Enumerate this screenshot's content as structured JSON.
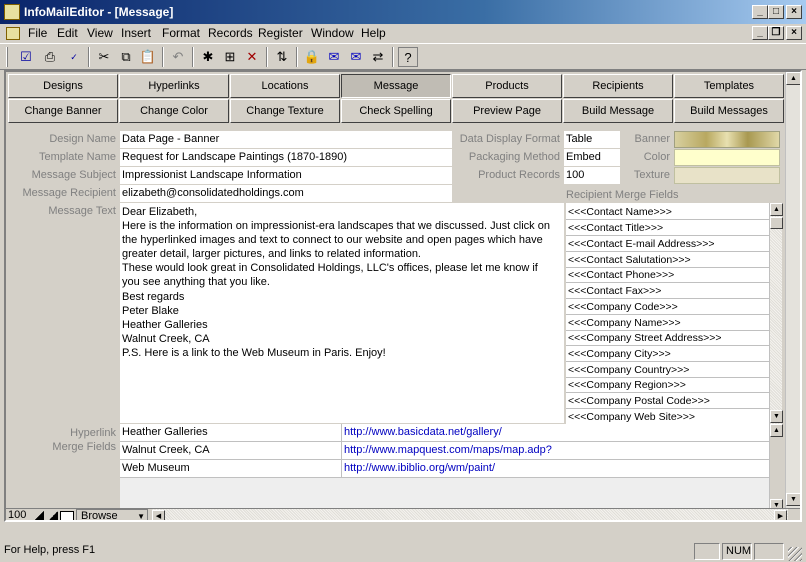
{
  "window": {
    "title": "InfoMailEditor - [Message]"
  },
  "menu": [
    "File",
    "Edit",
    "View",
    "Insert",
    "Format",
    "Records",
    "Register",
    "Window",
    "Help"
  ],
  "tabs_row1": [
    "Designs",
    "Hyperlinks",
    "Locations",
    "Message",
    "Products",
    "Recipients",
    "Templates"
  ],
  "tabs_row2": [
    "Change Banner",
    "Change Color",
    "Change Texture",
    "Check Spelling",
    "Preview Page",
    "Build Message",
    "Build Messages"
  ],
  "active_tab": "Message",
  "form": {
    "design_name_label": "Design Name",
    "design_name": "Data Page - Banner",
    "template_name_label": "Template Name",
    "template_name": "Request for Landscape Paintings (1870-1890)",
    "message_subject_label": "Message Subject",
    "message_subject": "Impressionist Landscape Information",
    "message_recipient_label": "Message Recipient",
    "message_recipient": "elizabeth@consolidatedholdings.com",
    "message_text_label": "Message Text",
    "data_display_format_label": "Data Display Format",
    "data_display_format": "Table",
    "packaging_method_label": "Packaging Method",
    "packaging_method": "Embed",
    "product_records_label": "Product Records",
    "product_records": "100",
    "banner_label": "Banner",
    "color_label": "Color",
    "texture_label": "Texture",
    "colors": {
      "color_swatch": "#ffffcc",
      "texture_swatch": "#e8e2c8"
    }
  },
  "message_text_lines": [
    "Dear Elizabeth,",
    "Here is the information on impressionist-era landscapes that we discussed. Just click on",
    "the hyperlinked images and text to connect to our website and open pages which have",
    "greater detail, larger pictures, and links to related information.",
    "These would look great in Consolidated Holdings, LLC's offices, please let me know if",
    "you see anything that you like.",
    "Best regards",
    "Peter Blake",
    "Heather Galleries",
    "Walnut Creek, CA",
    "P.S. Here is a link to the Web Museum in Paris. Enjoy!"
  ],
  "recipient_merge": {
    "label": "Recipient Merge Fields",
    "items": [
      "<<<Contact Name>>>",
      "<<<Contact Title>>>",
      "<<<Contact E-mail Address>>>",
      "<<<Contact Salutation>>>",
      "<<<Contact Phone>>>",
      "<<<Contact Fax>>>",
      "<<<Company Code>>>",
      "<<<Company Name>>>",
      "<<<Company Street Address>>>",
      "<<<Company City>>>",
      "<<<Company Country>>>",
      "<<<Company Region>>>",
      "<<<Company Postal Code>>>",
      "<<<Company Web Site>>>"
    ]
  },
  "hyperlink_merge": {
    "label_line1": "Hyperlink",
    "label_line2": "Merge Fields",
    "rows": [
      {
        "name": "Heather Galleries",
        "url": "http://www.basicdata.net/gallery/"
      },
      {
        "name": "Walnut Creek, CA",
        "url": "http://www.mapquest.com/maps/map.adp?"
      },
      {
        "name": "Web Museum",
        "url": "http://www.ibiblio.org/wm/paint/"
      }
    ]
  },
  "bottom_bar": {
    "zoom": "100",
    "mode": "Browse"
  },
  "status": {
    "help": "For Help, press F1",
    "num": "NUM"
  }
}
